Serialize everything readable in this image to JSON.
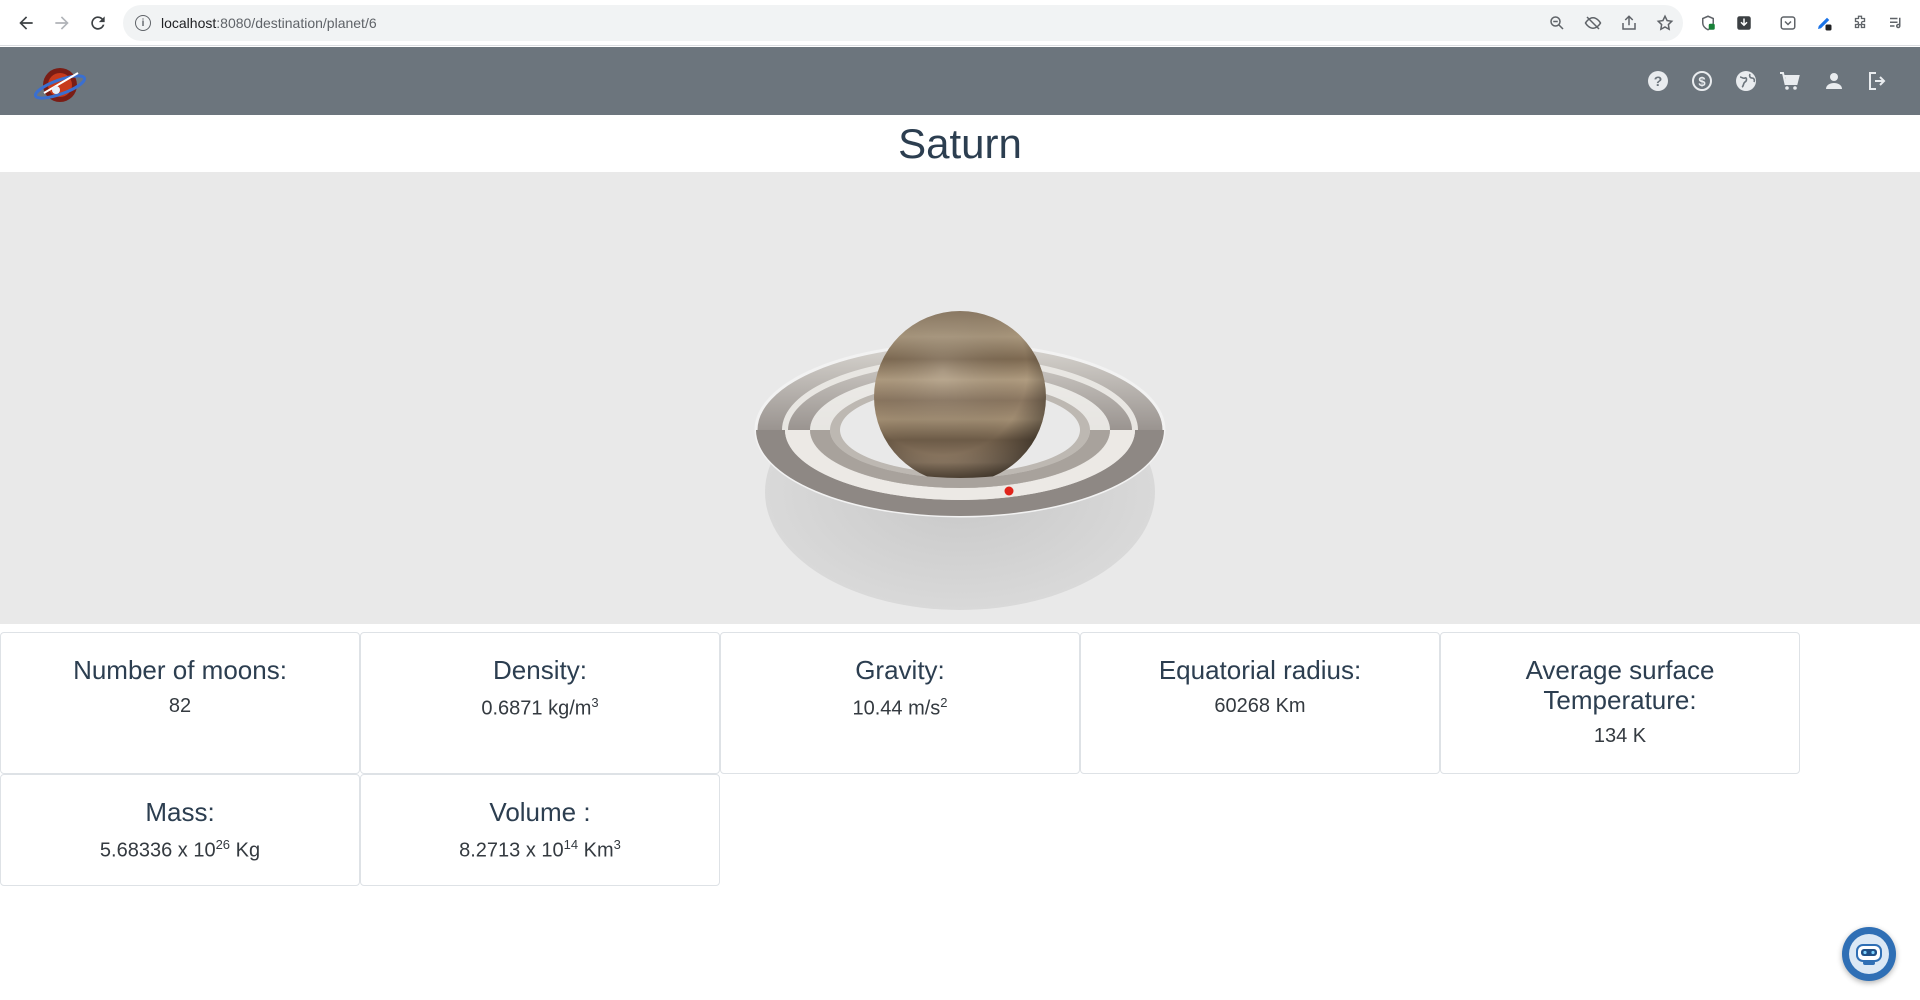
{
  "browser": {
    "url_host": "localhost",
    "url_path": ":8080/destination/planet/6"
  },
  "header": {
    "logo_alt": "Infinitude",
    "icons": [
      "help-icon",
      "exchange-icon",
      "globe-icon",
      "cart-icon",
      "user-icon",
      "logout-icon"
    ]
  },
  "planet": {
    "name": "Saturn"
  },
  "stats": {
    "moons": {
      "label": "Number of moons:",
      "value": "82"
    },
    "density": {
      "label": "Density:",
      "value": "0.6871 kg/m",
      "exp": "3"
    },
    "gravity": {
      "label": "Gravity:",
      "value": "10.44 m/s",
      "exp": "2"
    },
    "radius": {
      "label": "Equatorial radius:",
      "value": "60268 Km"
    },
    "temperature": {
      "label_line1": "Average surface",
      "label_line2": "Temperature:",
      "value": "134 K"
    },
    "mass": {
      "label": "Mass:",
      "value_pre": "5.68336 x 10",
      "exp": "26",
      "value_post": " Kg"
    },
    "volume": {
      "label": "Volume :",
      "value_pre": "8.2713 x 10",
      "exp": "14",
      "value_post": " Km",
      "unit_exp": "3"
    }
  },
  "colors": {
    "header_bg": "#6c757d",
    "viewer_bg": "#e9e9e9",
    "bot_bg": "#2f6fb5"
  }
}
